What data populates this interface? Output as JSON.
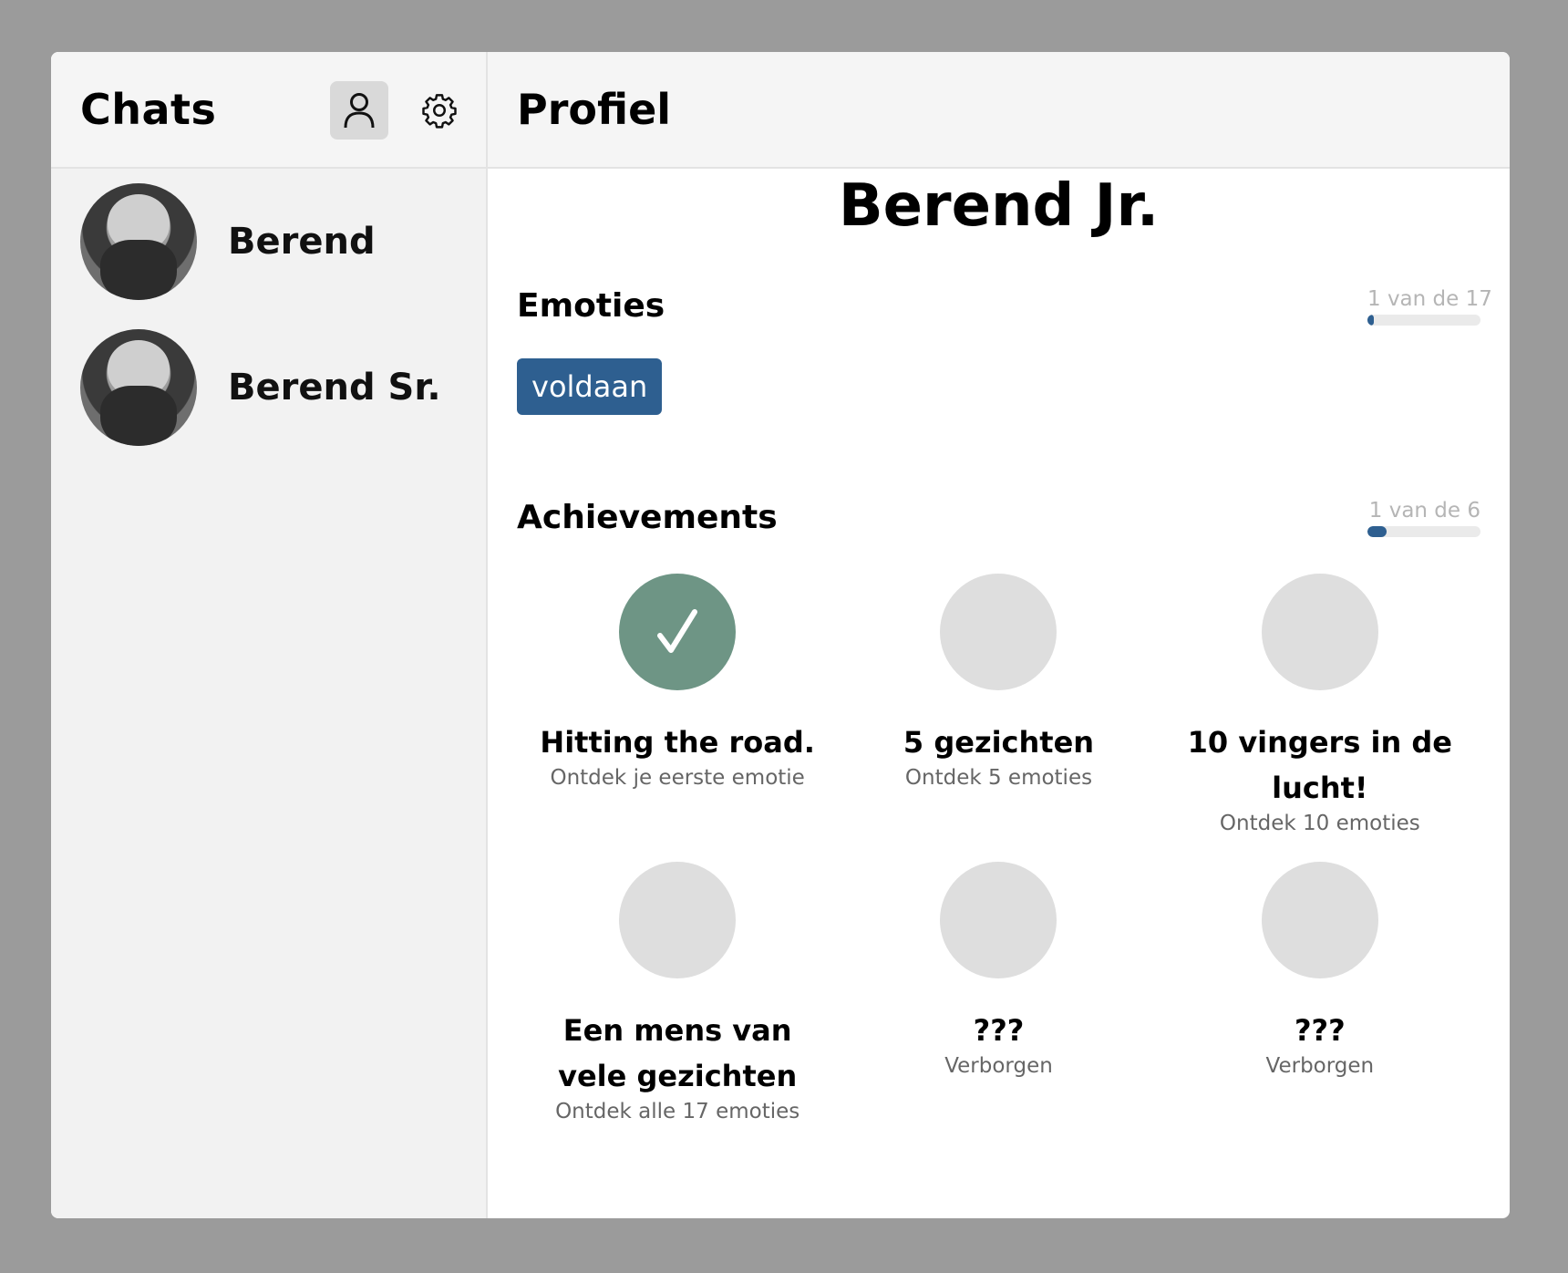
{
  "sidebar": {
    "title": "Chats",
    "chats": [
      {
        "name": "Berend"
      },
      {
        "name": "Berend Sr."
      }
    ]
  },
  "icons": {
    "profile": "person-icon",
    "settings": "gear-icon",
    "check": "checkmark-icon"
  },
  "main": {
    "title": "Profiel",
    "profile_name": "Berend Jr.",
    "emoties": {
      "title": "Emoties",
      "progress_label": "1 van de 17",
      "progress": 0.0588,
      "tags": [
        "voldaan"
      ]
    },
    "achievements": {
      "title": "Achievements",
      "progress_label": "1 van de 6",
      "progress": 0.1667,
      "items": [
        {
          "title": "Hitting the road.",
          "desc": "Ontdek je eerste emotie",
          "done": true
        },
        {
          "title": "5 gezichten",
          "desc": "Ontdek 5 emoties",
          "done": false
        },
        {
          "title": "10 vingers in de lucht!",
          "desc": "Ontdek 10 emoties",
          "done": false
        },
        {
          "title": "Een mens van vele gezichten",
          "desc": "Ontdek alle 17 emoties",
          "done": false
        },
        {
          "title": "???",
          "desc": "Verborgen",
          "done": false
        },
        {
          "title": "???",
          "desc": "Verborgen",
          "done": false
        }
      ]
    }
  },
  "colors": {
    "accent": "#2e5f90",
    "achieved": "#6e9585",
    "locked": "#dedede"
  }
}
